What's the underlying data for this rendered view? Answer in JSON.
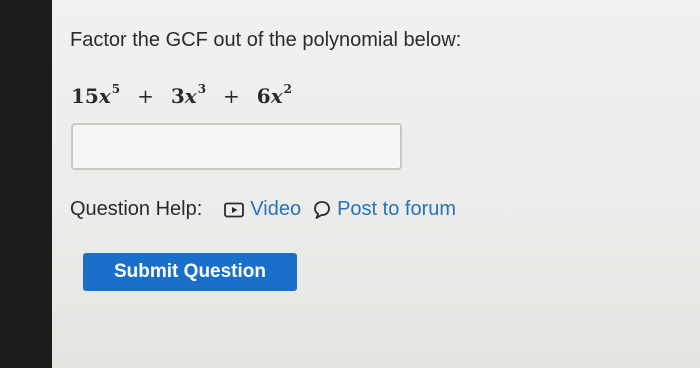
{
  "question": {
    "prompt": "Factor the GCF out of the polynomial below:",
    "polynomial": {
      "term1_coef": "15",
      "term1_var": "x",
      "term1_exp": "5",
      "op1": "+",
      "term2_coef": "3",
      "term2_var": "x",
      "term2_exp": "3",
      "op2": "+",
      "term3_coef": "6",
      "term3_var": "x",
      "term3_exp": "2"
    }
  },
  "answer": {
    "value": "",
    "placeholder": ""
  },
  "help": {
    "label": "Question Help:",
    "video_label": "Video",
    "video_icon": "video-icon",
    "forum_label": "Post to forum",
    "forum_icon": "speech-bubble-icon"
  },
  "submit": {
    "label": "Submit Question"
  },
  "colors": {
    "link": "#2a72b8",
    "button": "#1a6fc9"
  }
}
